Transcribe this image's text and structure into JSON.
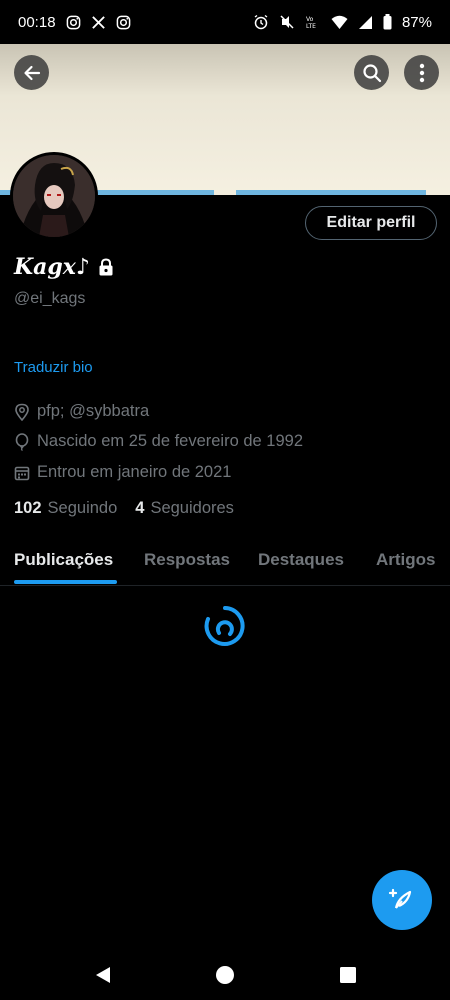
{
  "status_bar": {
    "time": "00:18",
    "battery": "87%"
  },
  "profile": {
    "display_name": "Kagx♪",
    "handle": "@ei_kags",
    "edit_button": "Editar perfil",
    "translate_bio": "Traduzir bio",
    "location": "pfp; @sybbatra",
    "birthday": "Nascido em 25 de fevereiro de 1992",
    "joined": "Entrou em janeiro de 2021",
    "following_count": "102",
    "following_label": "Seguindo",
    "followers_count": "4",
    "followers_label": "Seguidores"
  },
  "tabs": [
    {
      "label": "Publicações",
      "active": true
    },
    {
      "label": "Respostas",
      "active": false
    },
    {
      "label": "Destaques",
      "active": false
    },
    {
      "label": "Artigos",
      "active": false
    }
  ],
  "icons": {
    "back": "arrow-left-icon",
    "search": "search-icon",
    "more": "more-vertical-icon",
    "lock": "lock-icon",
    "location": "location-pin-icon",
    "birthday": "balloon-icon",
    "calendar": "calendar-icon",
    "compose": "compose-post-icon"
  },
  "colors": {
    "accent": "#1d9bf0",
    "background": "#000000",
    "secondary_text": "#71767b"
  }
}
